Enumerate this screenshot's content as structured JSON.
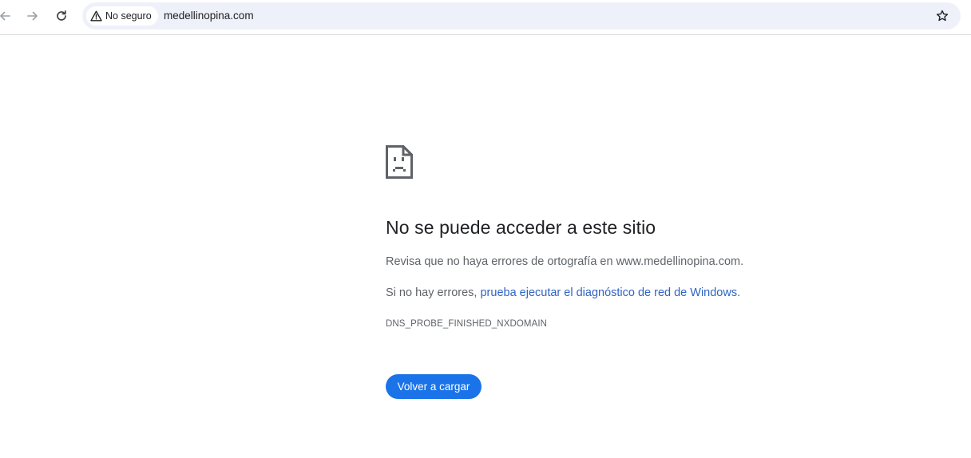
{
  "toolbar": {
    "back_icon": "arrow-left-icon",
    "forward_icon": "arrow-right-icon",
    "reload_icon": "reload-icon",
    "security_chip": {
      "icon": "warning-triangle-icon",
      "label": "No seguro"
    },
    "url": "medellinopina.com",
    "bookmark_icon": "star-outline-icon"
  },
  "error_page": {
    "icon": "sad-page-icon",
    "title": "No se puede acceder a este sitio",
    "line1": "Revisa que no haya errores de ortografía en www.medellinopina.com.",
    "line2_prefix": "Si no hay errores, ",
    "line2_link": "prueba ejecutar el diagnóstico de red de Windows",
    "line2_suffix": ".",
    "error_code": "DNS_PROBE_FINISHED_NXDOMAIN",
    "reload_button": "Volver a cargar"
  },
  "colors": {
    "accent": "#1a73e8",
    "link": "#2f64c4",
    "omnibox_bg": "#eef1f9",
    "text_secondary": "#5f6368"
  }
}
